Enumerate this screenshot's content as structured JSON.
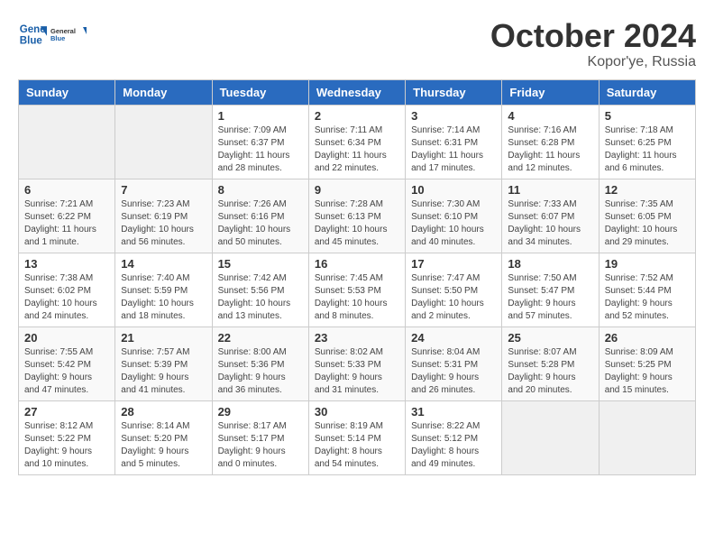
{
  "header": {
    "logo_line1": "General",
    "logo_line2": "Blue",
    "month": "October 2024",
    "location": "Kopor'ye, Russia"
  },
  "weekdays": [
    "Sunday",
    "Monday",
    "Tuesday",
    "Wednesday",
    "Thursday",
    "Friday",
    "Saturday"
  ],
  "weeks": [
    [
      {
        "day": "",
        "info": ""
      },
      {
        "day": "",
        "info": ""
      },
      {
        "day": "1",
        "info": "Sunrise: 7:09 AM\nSunset: 6:37 PM\nDaylight: 11 hours and 28 minutes."
      },
      {
        "day": "2",
        "info": "Sunrise: 7:11 AM\nSunset: 6:34 PM\nDaylight: 11 hours and 22 minutes."
      },
      {
        "day": "3",
        "info": "Sunrise: 7:14 AM\nSunset: 6:31 PM\nDaylight: 11 hours and 17 minutes."
      },
      {
        "day": "4",
        "info": "Sunrise: 7:16 AM\nSunset: 6:28 PM\nDaylight: 11 hours and 12 minutes."
      },
      {
        "day": "5",
        "info": "Sunrise: 7:18 AM\nSunset: 6:25 PM\nDaylight: 11 hours and 6 minutes."
      }
    ],
    [
      {
        "day": "6",
        "info": "Sunrise: 7:21 AM\nSunset: 6:22 PM\nDaylight: 11 hours and 1 minute."
      },
      {
        "day": "7",
        "info": "Sunrise: 7:23 AM\nSunset: 6:19 PM\nDaylight: 10 hours and 56 minutes."
      },
      {
        "day": "8",
        "info": "Sunrise: 7:26 AM\nSunset: 6:16 PM\nDaylight: 10 hours and 50 minutes."
      },
      {
        "day": "9",
        "info": "Sunrise: 7:28 AM\nSunset: 6:13 PM\nDaylight: 10 hours and 45 minutes."
      },
      {
        "day": "10",
        "info": "Sunrise: 7:30 AM\nSunset: 6:10 PM\nDaylight: 10 hours and 40 minutes."
      },
      {
        "day": "11",
        "info": "Sunrise: 7:33 AM\nSunset: 6:07 PM\nDaylight: 10 hours and 34 minutes."
      },
      {
        "day": "12",
        "info": "Sunrise: 7:35 AM\nSunset: 6:05 PM\nDaylight: 10 hours and 29 minutes."
      }
    ],
    [
      {
        "day": "13",
        "info": "Sunrise: 7:38 AM\nSunset: 6:02 PM\nDaylight: 10 hours and 24 minutes."
      },
      {
        "day": "14",
        "info": "Sunrise: 7:40 AM\nSunset: 5:59 PM\nDaylight: 10 hours and 18 minutes."
      },
      {
        "day": "15",
        "info": "Sunrise: 7:42 AM\nSunset: 5:56 PM\nDaylight: 10 hours and 13 minutes."
      },
      {
        "day": "16",
        "info": "Sunrise: 7:45 AM\nSunset: 5:53 PM\nDaylight: 10 hours and 8 minutes."
      },
      {
        "day": "17",
        "info": "Sunrise: 7:47 AM\nSunset: 5:50 PM\nDaylight: 10 hours and 2 minutes."
      },
      {
        "day": "18",
        "info": "Sunrise: 7:50 AM\nSunset: 5:47 PM\nDaylight: 9 hours and 57 minutes."
      },
      {
        "day": "19",
        "info": "Sunrise: 7:52 AM\nSunset: 5:44 PM\nDaylight: 9 hours and 52 minutes."
      }
    ],
    [
      {
        "day": "20",
        "info": "Sunrise: 7:55 AM\nSunset: 5:42 PM\nDaylight: 9 hours and 47 minutes."
      },
      {
        "day": "21",
        "info": "Sunrise: 7:57 AM\nSunset: 5:39 PM\nDaylight: 9 hours and 41 minutes."
      },
      {
        "day": "22",
        "info": "Sunrise: 8:00 AM\nSunset: 5:36 PM\nDaylight: 9 hours and 36 minutes."
      },
      {
        "day": "23",
        "info": "Sunrise: 8:02 AM\nSunset: 5:33 PM\nDaylight: 9 hours and 31 minutes."
      },
      {
        "day": "24",
        "info": "Sunrise: 8:04 AM\nSunset: 5:31 PM\nDaylight: 9 hours and 26 minutes."
      },
      {
        "day": "25",
        "info": "Sunrise: 8:07 AM\nSunset: 5:28 PM\nDaylight: 9 hours and 20 minutes."
      },
      {
        "day": "26",
        "info": "Sunrise: 8:09 AM\nSunset: 5:25 PM\nDaylight: 9 hours and 15 minutes."
      }
    ],
    [
      {
        "day": "27",
        "info": "Sunrise: 8:12 AM\nSunset: 5:22 PM\nDaylight: 9 hours and 10 minutes."
      },
      {
        "day": "28",
        "info": "Sunrise: 8:14 AM\nSunset: 5:20 PM\nDaylight: 9 hours and 5 minutes."
      },
      {
        "day": "29",
        "info": "Sunrise: 8:17 AM\nSunset: 5:17 PM\nDaylight: 9 hours and 0 minutes."
      },
      {
        "day": "30",
        "info": "Sunrise: 8:19 AM\nSunset: 5:14 PM\nDaylight: 8 hours and 54 minutes."
      },
      {
        "day": "31",
        "info": "Sunrise: 8:22 AM\nSunset: 5:12 PM\nDaylight: 8 hours and 49 minutes."
      },
      {
        "day": "",
        "info": ""
      },
      {
        "day": "",
        "info": ""
      }
    ]
  ]
}
